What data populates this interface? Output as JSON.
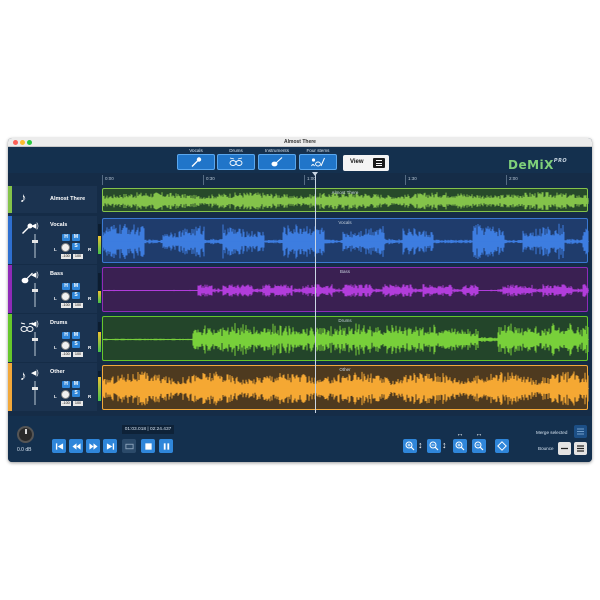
{
  "window": {
    "title": "Almost There"
  },
  "toolbar": {
    "stems": [
      {
        "label": "Vocals",
        "icon": "microphone-icon"
      },
      {
        "label": "Drums",
        "icon": "drum-kit-icon"
      },
      {
        "label": "Instruments",
        "icon": "guitar-icon"
      },
      {
        "label": "Four stems",
        "icon": "four-stems-icon"
      }
    ],
    "view_label": "View",
    "logo_text": "DeMiX",
    "logo_suffix": "PRO"
  },
  "ruler": {
    "ticks": [
      "0:00",
      "0:30",
      "1:00",
      "1:30",
      "2:00"
    ]
  },
  "tracks": [
    {
      "name": "Almost There",
      "color": "#84c34a",
      "number": "",
      "lane_label": "Almost There",
      "has_controls": false
    },
    {
      "name": "Vocals",
      "color": "#2e6fd0",
      "number": "1",
      "lane_label": "Vocals",
      "has_controls": true,
      "h": "H",
      "m": "M",
      "s": "S",
      "l": "L",
      "r": "R",
      "pan_l": "-100",
      "pan_r": "100"
    },
    {
      "name": "Bass",
      "color": "#8f2ab8",
      "number": "2",
      "lane_label": "Bass",
      "has_controls": true,
      "h": "H",
      "m": "M",
      "s": "S",
      "l": "L",
      "r": "R",
      "pan_l": "-100",
      "pan_r": "100"
    },
    {
      "name": "Drums",
      "color": "#66c72b",
      "number": "3",
      "lane_label": "Drums",
      "has_controls": true,
      "h": "H",
      "m": "M",
      "s": "S",
      "l": "L",
      "r": "R",
      "pan_l": "-100",
      "pan_r": "100"
    },
    {
      "name": "Other",
      "color": "#f2a83a",
      "number": "4",
      "lane_label": "Other",
      "has_controls": true,
      "h": "H",
      "m": "M",
      "s": "S",
      "l": "L",
      "r": "R",
      "pan_l": "-100",
      "pan_r": "100"
    }
  ],
  "footer": {
    "master_volume": "0.0 dB",
    "timecode": "01:03.018 | 02:24.437",
    "merge_selected_label": "Merge selected",
    "bounce_label": "Bounce"
  },
  "colors": {
    "accent": "#2f86da",
    "background": "#152c47",
    "vocals": "#2e6fd0",
    "bass": "#8f2ab8",
    "drums": "#66c72b",
    "other": "#f2a83a",
    "mix": "#84c34a"
  }
}
